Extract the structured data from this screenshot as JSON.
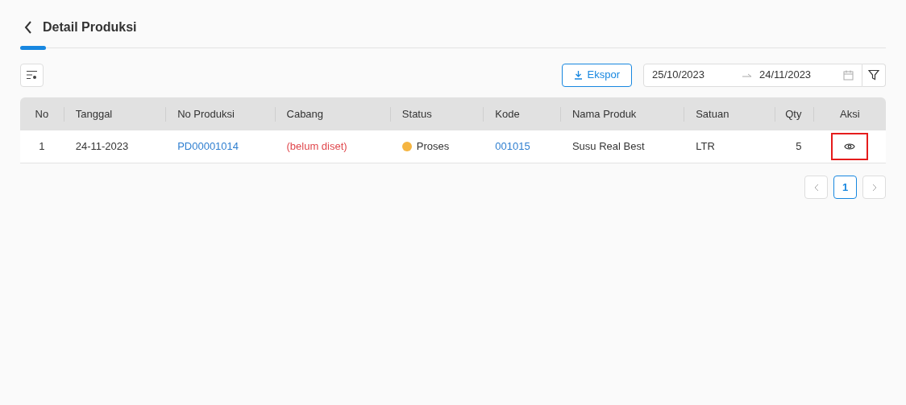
{
  "header": {
    "title": "Detail Produksi",
    "tab_indicator": true
  },
  "toolbar": {
    "export_label": "Ekspor",
    "date_start": "25/10/2023",
    "date_end": "24/11/2023"
  },
  "table": {
    "columns": [
      "No",
      "Tanggal",
      "No Produksi",
      "Cabang",
      "Status",
      "Kode",
      "Nama Produk",
      "Satuan",
      "Qty",
      "Aksi"
    ],
    "rows": [
      {
        "no": "1",
        "tanggal": "24-11-2023",
        "no_produksi": "PD00001014",
        "cabang": "(belum diset)",
        "cabang_unset": true,
        "status": {
          "label": "Proses",
          "color": "#f5b541"
        },
        "kode": "001015",
        "nama_produk": "Susu Real Best",
        "satuan": "LTR",
        "qty": "5",
        "view_highlighted": true
      }
    ]
  },
  "pagination": {
    "prev_disabled": true,
    "next_disabled": true,
    "pages": [
      {
        "label": "1",
        "selected": true
      }
    ]
  }
}
